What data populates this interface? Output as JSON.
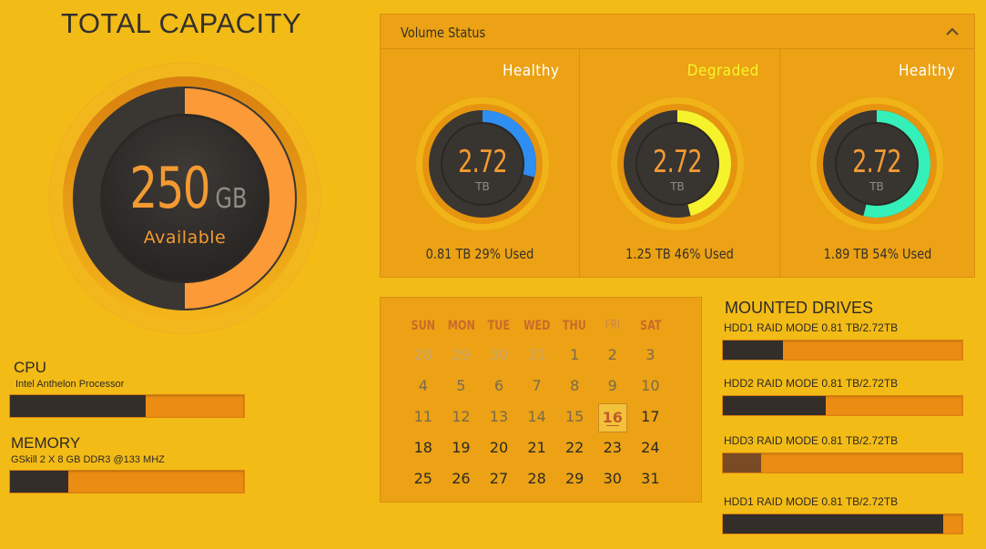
{
  "total": {
    "title": "TOTAL CAPACITY",
    "value": "250",
    "unit": "GB",
    "label": "Available",
    "ring_fill_fraction": 0.5,
    "ring_color": "#fb9a36"
  },
  "cpu": {
    "label": "CPU",
    "name": "Intel Anthelon Processor",
    "usage_fraction": 0.58
  },
  "memory": {
    "label": "MEMORY",
    "name": "GSkill 2 X 8 GB DDR3 @133 MHZ",
    "usage_fraction": 0.25
  },
  "volume_status": {
    "title": "Volume Status",
    "collapse_icon": "chevron-up-icon",
    "volumes": [
      {
        "status": "Healthy",
        "status_color": "#ffffff",
        "value": "2.72",
        "unit": "TB",
        "used_text": "0.81 TB 29% Used",
        "used_fraction": 0.29,
        "ring_color": "#2f8ef2"
      },
      {
        "status": "Degraded",
        "status_color": "#f5f52a",
        "value": "2.72",
        "unit": "TB",
        "used_text": "1.25 TB 46% Used",
        "used_fraction": 0.46,
        "ring_color": "#f6f22c"
      },
      {
        "status": "Healthy",
        "status_color": "#ffffff",
        "value": "2.72",
        "unit": "TB",
        "used_text": "1.89 TB 54% Used",
        "used_fraction": 0.54,
        "ring_color": "#35f0b8"
      }
    ]
  },
  "calendar": {
    "headers": [
      "SUN",
      "MON",
      "TUE",
      "WED",
      "THU",
      "FRI",
      "SAT"
    ],
    "weeks": [
      [
        "28",
        "29",
        "30",
        "31",
        "1",
        "2",
        "3"
      ],
      [
        "4",
        "5",
        "6",
        "7",
        "8",
        "9",
        "10"
      ],
      [
        "11",
        "12",
        "13",
        "14",
        "15",
        "16",
        "17"
      ],
      [
        "18",
        "19",
        "20",
        "21",
        "22",
        "23",
        "24"
      ],
      [
        "25",
        "26",
        "27",
        "28",
        "29",
        "30",
        "31"
      ]
    ],
    "today": "16"
  },
  "mounted_drives": {
    "title": "MOUNTED DRIVES",
    "drives": [
      {
        "label": "HDD1  RAID MODE 0.81 TB/2.72TB",
        "fill_fraction": 0.25,
        "fill_color": "#332e2a"
      },
      {
        "label": "HDD2  RAID MODE 0.81 TB/2.72TB",
        "fill_fraction": 0.43,
        "fill_color": "#332e2a"
      },
      {
        "label": "HDD3  RAID MODE 0.81 TB/2.72TB",
        "fill_fraction": 0.16,
        "fill_color": "#7a4a24"
      },
      {
        "label": "HDD1  RAID MODE 0.81 TB/2.72TB",
        "fill_fraction": 0.92,
        "fill_color": "#332e2a"
      }
    ]
  }
}
